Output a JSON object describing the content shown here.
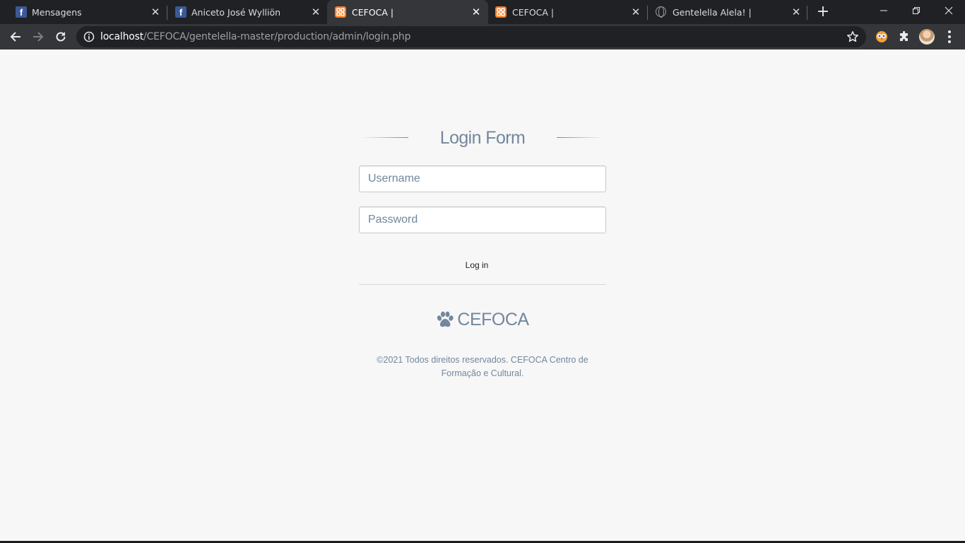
{
  "browser": {
    "tabs": [
      {
        "title": "Mensagens",
        "favicon": "facebook-icon",
        "active": false
      },
      {
        "title": "Aniceto José Wylliön",
        "favicon": "facebook-icon",
        "active": false
      },
      {
        "title": "CEFOCA |",
        "favicon": "xampp-icon",
        "active": true
      },
      {
        "title": "CEFOCA |",
        "favicon": "xampp-icon",
        "active": false
      },
      {
        "title": "Gentelella Alela! |",
        "favicon": "globe-icon",
        "active": false
      }
    ],
    "close_glyph": "✕",
    "new_tab_glyph": "+",
    "url_host": "localhost",
    "url_path": "/CEFOCA/gentelella-master/production/admin/login.php"
  },
  "login": {
    "heading": "Login Form",
    "username_placeholder": "Username",
    "password_placeholder": "Password",
    "submit_label": "Log in"
  },
  "brand": {
    "name": "CEFOCA",
    "icon": "paw-icon"
  },
  "footer": {
    "copyright_line1": "©2021 Todos direitos reservados. CEFOCA Centro de",
    "copyright_line2": "Formação e Cultural."
  },
  "colors": {
    "accent_text": "#73879c",
    "page_background": "#f7f7f7",
    "chrome_dark": "#202124",
    "chrome_toolbar": "#35363a",
    "xampp_orange": "#fb7a24",
    "facebook_blue": "#3b5998"
  }
}
